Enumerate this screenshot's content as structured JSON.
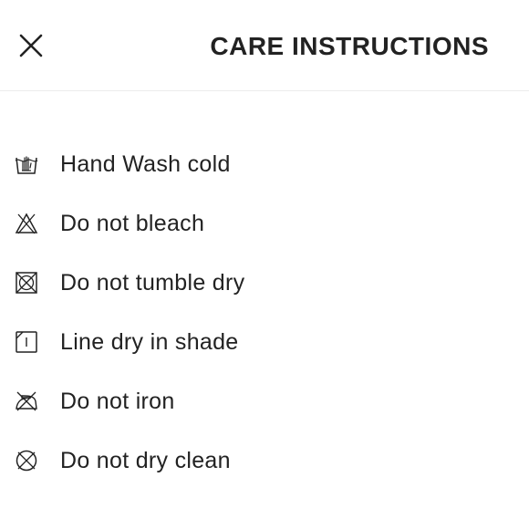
{
  "header": {
    "title": "CARE INSTRUCTIONS",
    "close_icon": "close-icon"
  },
  "instructions": [
    {
      "icon": "hand-wash-icon",
      "label": "Hand Wash cold"
    },
    {
      "icon": "do-not-bleach-icon",
      "label": "Do not bleach"
    },
    {
      "icon": "do-not-tumble-dry-icon",
      "label": "Do not tumble dry"
    },
    {
      "icon": "line-dry-shade-icon",
      "label": "Line dry in shade"
    },
    {
      "icon": "do-not-iron-icon",
      "label": "Do not iron"
    },
    {
      "icon": "do-not-dry-clean-icon",
      "label": "Do not dry clean"
    }
  ]
}
